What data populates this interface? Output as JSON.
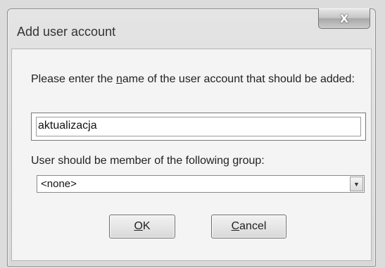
{
  "dialog": {
    "title": "Add user account",
    "close_label": "X"
  },
  "form": {
    "prompt_before_mnemonic": "Please enter the ",
    "prompt_mnemonic": "n",
    "prompt_after_mnemonic": "ame of the user account that should be added:",
    "username_value": "aktualizacja",
    "group_label_before": "User should be member of the following ",
    "group_label_mnemonic": "g",
    "group_label_after": "roup:",
    "group_selected": "<none>",
    "group_arrow": "▼"
  },
  "buttons": {
    "ok_mnemonic": "O",
    "ok_rest": "K",
    "cancel_mnemonic": "C",
    "cancel_rest": "ancel"
  }
}
